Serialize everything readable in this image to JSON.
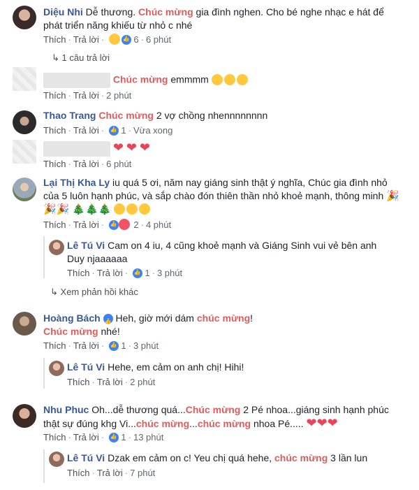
{
  "actions": {
    "like": "Thích",
    "reply": "Trả lời"
  },
  "comments": [
    {
      "name": "Diệu Nhi",
      "text_before": " Dễ thương. ",
      "highlight": "Chúc mừng",
      "text_after": " gia đình nghen. Cho bé nghe nhạc e hát để",
      "line2": "phát triển năng khiếu từ nhỏ c nhé",
      "reaction_count": "6",
      "time": "6 phút",
      "replies_link": "1 câu trả lời"
    },
    {
      "highlight": "Chúc mừng",
      "text_after": " emmmm",
      "time": "2 phút"
    },
    {
      "name": "Thao Trang",
      "highlight": "Chúc mừng",
      "text_after": " 2 vợ chồng nhennnnnnnn",
      "reaction_count": "1",
      "time": "Vừa xong"
    },
    {
      "time": "6 phút"
    },
    {
      "name": "Lại Thị Kha Ly",
      "text_after": " iu quá 5 ơi, năm nay giáng sinh thật ý nghĩa, Chúc gia đình nhỏ",
      "line2": "của 5 luôn hạnh phúc, và sắp chào đón thiên thần nhỏ khoẻ mạnh, thông minh",
      "reaction_count": "2",
      "time": "4 phút",
      "reply": {
        "name": "Lê Tú Vi",
        "text": " Cam on 4 iu, 4 cũng khoẻ mạnh và Giáng Sinh vui vẻ bên anh",
        "line2": "Duy njaaaaaa",
        "reaction_count": "1",
        "time": "3 phút"
      },
      "more_replies": "Xem phản hồi khác"
    },
    {
      "name": "Hoàng Bách",
      "text_before": " Heh, giờ mới dám ",
      "highlight": "chúc mừng",
      "text_after": "!",
      "line2_highlight": "Chúc mừng",
      "line2_after": " nhé!",
      "reaction_count": "1",
      "time": "3 phút",
      "reply": {
        "name": "Lê Tú Vi",
        "text": " Hehe, em cảm on anh chị! Hihi!",
        "time": "2 phút"
      }
    },
    {
      "name": "Nhu Phuc",
      "text_before": " Oh...dễ thương quá...",
      "highlight": "Chúc mừng",
      "text_after": " 2 Pé nhoa...giáng sinh hạnh phúc",
      "line2_before": "thật sự đúng khg Vi...",
      "line2_highlight": "chúc mừng",
      "line2_mid": "...",
      "line2_highlight2": "chúc mừng",
      "line2_after": " nhoa Pé.....",
      "reaction_count": "1",
      "time": "13 phút",
      "reply": {
        "name": "Lê Tú Vi",
        "text_before": " Dzak em cảm on c! Yeu chị quá hehe, ",
        "highlight": "chúc mừng",
        "text_after": " 3 lần lun",
        "time": "7 phút"
      }
    }
  ],
  "colors": {
    "name": "#385898",
    "highlight": "#e05c5c",
    "action": "#606770",
    "like_badge": "#3b82f6"
  }
}
